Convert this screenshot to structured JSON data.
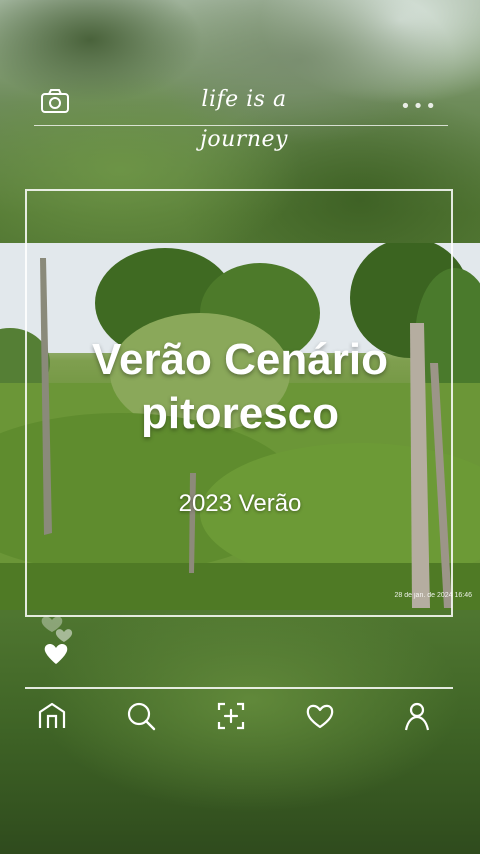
{
  "header": {
    "brand_text": "life is a journey",
    "camera_icon": "camera-icon",
    "more_icon": "more-dots-icon"
  },
  "post": {
    "title": "Verão Cenário pitoresco",
    "subtitle": "2023 Verão",
    "timestamp": "28 de jan. de 2024 16:46"
  },
  "reactions": {
    "icon": "hearts-icon"
  },
  "nav": {
    "items": [
      {
        "icon": "home-icon"
      },
      {
        "icon": "search-icon"
      },
      {
        "icon": "add-post-icon"
      },
      {
        "icon": "heart-icon"
      },
      {
        "icon": "profile-icon"
      }
    ]
  },
  "colors": {
    "accent": "#ffffff",
    "foliage": "#5f8a2f"
  }
}
